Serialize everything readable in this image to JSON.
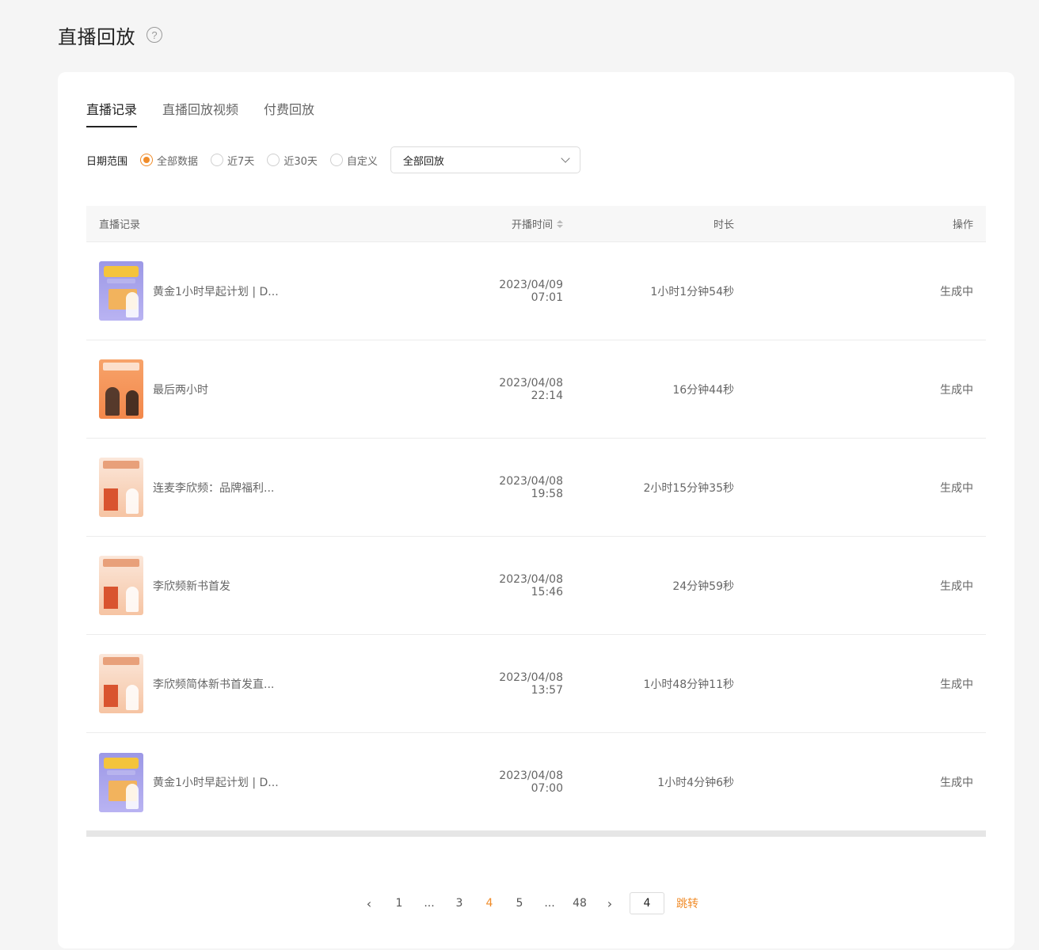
{
  "header": {
    "title": "直播回放",
    "help_glyph": "?"
  },
  "tabs": [
    {
      "label": "直播记录",
      "active": true
    },
    {
      "label": "直播回放视频",
      "active": false
    },
    {
      "label": "付费回放",
      "active": false
    }
  ],
  "filter": {
    "label": "日期范围",
    "options": [
      {
        "label": "全部数据",
        "checked": true
      },
      {
        "label": "近7天",
        "checked": false
      },
      {
        "label": "近30天",
        "checked": false
      },
      {
        "label": "自定义",
        "checked": false
      }
    ],
    "select_value": "全部回放"
  },
  "table": {
    "headers": {
      "record": "直播记录",
      "start_time": "开播时间",
      "duration": "时长",
      "action": "操作"
    },
    "rows": [
      {
        "name": "黄金1小时早起计划 | D...",
        "start_time": "2023/04/09 07:01",
        "duration": "1小时1分钟54秒",
        "action": "生成中",
        "thumb": "blue"
      },
      {
        "name": "最后两小时",
        "start_time": "2023/04/08 22:14",
        "duration": "16分钟44秒",
        "action": "生成中",
        "thumb": "orange"
      },
      {
        "name": "连麦李欣频：品牌福利...",
        "start_time": "2023/04/08 19:58",
        "duration": "2小时15分钟35秒",
        "action": "生成中",
        "thumb": "peach"
      },
      {
        "name": "李欣频新书首发",
        "start_time": "2023/04/08 15:46",
        "duration": "24分钟59秒",
        "action": "生成中",
        "thumb": "peach"
      },
      {
        "name": "李欣频简体新书首发直...",
        "start_time": "2023/04/08 13:57",
        "duration": "1小时48分钟11秒",
        "action": "生成中",
        "thumb": "peach"
      },
      {
        "name": "黄金1小时早起计划 | D...",
        "start_time": "2023/04/08 07:00",
        "duration": "1小时4分钟6秒",
        "action": "生成中",
        "thumb": "blue"
      }
    ]
  },
  "pagination": {
    "prev": "‹",
    "pages": [
      "1",
      "...",
      "3",
      "4",
      "5",
      "...",
      "48"
    ],
    "current": "4",
    "next": "›",
    "jump_value": "4",
    "jump_label": "跳转"
  },
  "colors": {
    "accent": "#f08c2a"
  }
}
